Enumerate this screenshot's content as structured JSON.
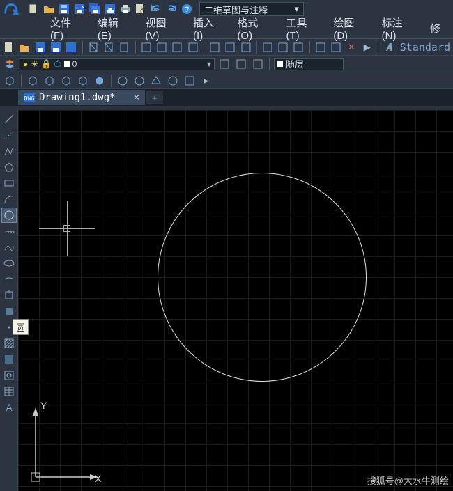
{
  "workspace": {
    "label": "二维草图与注释"
  },
  "menu": {
    "file": "文件(F)",
    "edit": "编辑(E)",
    "view": "视图(V)",
    "insert": "插入(I)",
    "format": "格式(O)",
    "tools": "工具(T)",
    "draw": "绘图(D)",
    "dim": "标注(N)",
    "mod": "修"
  },
  "style": {
    "current": "Standard",
    "glyph": "A"
  },
  "layer": {
    "name": "0"
  },
  "color": {
    "bylayer": "随层"
  },
  "doc": {
    "tab_label": "Drawing1.dwg*",
    "close": "×",
    "new": "+"
  },
  "tooltip": {
    "circle": "圆"
  },
  "ucs": {
    "x": "X",
    "y": "Y"
  },
  "watermark": "搜狐号@大水牛测绘"
}
